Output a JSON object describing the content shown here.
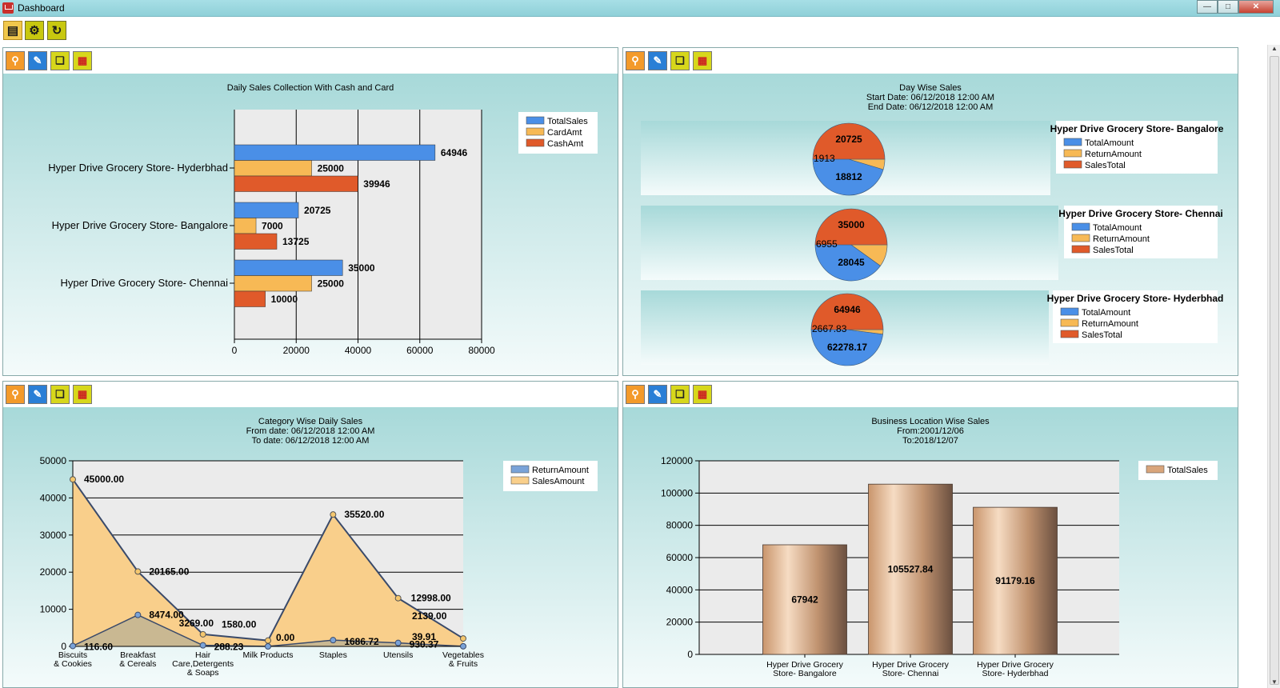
{
  "window": {
    "title": "Dashboard"
  },
  "toolbar": {
    "buttons": [
      "report-icon",
      "settings-icon",
      "refresh-icon"
    ]
  },
  "panel_tools": [
    "zoom-icon",
    "edit-icon",
    "copy-icon",
    "grid-icon"
  ],
  "colors": {
    "blue": "#4a8fe7",
    "orange": "#f7b955",
    "red": "#e05a2a",
    "bronze": "#d9a57b"
  },
  "chart_data": [
    {
      "type": "bar",
      "title": "Daily Sales Collection With Cash and Card",
      "orientation": "horizontal",
      "categories": [
        "Hyper Drive Grocery Store- Hyderbhad",
        "Hyper Drive Grocery Store- Bangalore",
        "Hyper Drive Grocery Store- Chennai"
      ],
      "series": [
        {
          "name": "TotalSales",
          "values": [
            64946,
            20725,
            35000
          ],
          "labels": [
            "64946",
            "20725",
            "35000"
          ]
        },
        {
          "name": "CardAmt",
          "values": [
            25000,
            7000,
            25000
          ],
          "labels": [
            "25000",
            "7000",
            "25000"
          ]
        },
        {
          "name": "CashAmt",
          "values": [
            39946,
            13725,
            10000
          ],
          "labels": [
            "39946",
            "13725",
            "10000"
          ]
        }
      ],
      "xlim": [
        0,
        80000
      ],
      "ticks": [
        "0",
        "20000",
        "40000",
        "60000",
        "80000"
      ],
      "legend": "top-right"
    },
    {
      "type": "pie",
      "title": "Day Wise Sales",
      "subtitle1": "Start Date: 06/12/2018 12:00 AM",
      "subtitle2": "End Date: 06/12/2018 12:00 AM",
      "series_names": [
        "TotalAmount",
        "ReturnAmount",
        "SalesTotal"
      ],
      "pies": [
        {
          "name": "Hyper Drive Grocery Store- Bangalore",
          "values": [
            18812,
            1913,
            20725
          ],
          "labels": [
            "18812",
            "1913",
            "20725"
          ]
        },
        {
          "name": "Hyper Drive Grocery Store- Chennai",
          "values": [
            28045,
            6955,
            35000
          ],
          "labels": [
            "28045",
            "6955",
            "35000"
          ]
        },
        {
          "name": "Hyper Drive Grocery Store- Hyderbhad",
          "values": [
            62278.17,
            2667.83,
            64946
          ],
          "labels": [
            "62278.17",
            "2667.83",
            "64946"
          ]
        }
      ]
    },
    {
      "type": "area",
      "title": "Category Wise Daily Sales",
      "subtitle1": "From date: 06/12/2018 12:00 AM",
      "subtitle2": "To date: 06/12/2018 12:00 AM",
      "categories": [
        [
          "Biscuits",
          "& Cookies"
        ],
        [
          "Breakfast",
          "& Cereals"
        ],
        [
          "Hair",
          "Care,Detergents",
          "& Soaps"
        ],
        [
          "Milk Products"
        ],
        [
          "Staples"
        ],
        [
          "Utensils"
        ],
        [
          "Vegetables",
          "& Fruits"
        ]
      ],
      "series": [
        {
          "name": "ReturnAmount",
          "values": [
            116.6,
            8474,
            288.23,
            0,
            1686.72,
            930.37,
            39.91
          ],
          "labels": [
            "116.60",
            "8474.00",
            "288.23",
            "0.00",
            "1686.72",
            "930.37",
            "39.91"
          ]
        },
        {
          "name": "SalesAmount",
          "values": [
            45000,
            20165,
            3269,
            1580,
            35520,
            12998,
            2139
          ],
          "labels": [
            "45000.00",
            "20165.00",
            "3269.00",
            "1580.00",
            "35520.00",
            "12998.00",
            "2139.00"
          ]
        }
      ],
      "ylim": [
        0,
        50000
      ],
      "ticks": [
        "0",
        "10000",
        "20000",
        "30000",
        "40000",
        "50000"
      ],
      "legend": "top-right"
    },
    {
      "type": "bar",
      "title": "Business Location Wise Sales",
      "subtitle1": "From:2001/12/06",
      "subtitle2": "To:2018/12/07",
      "categories": [
        [
          "Hyper Drive Grocery",
          "Store- Bangalore"
        ],
        [
          "Hyper Drive Grocery",
          "Store- Chennai"
        ],
        [
          "Hyper Drive Grocery",
          "Store- Hyderbhad"
        ]
      ],
      "series": [
        {
          "name": "TotalSales",
          "values": [
            67942,
            105527.84,
            91179.16
          ],
          "labels": [
            "67942",
            "105527.84",
            "91179.16"
          ]
        }
      ],
      "ylim": [
        0,
        120000
      ],
      "ticks": [
        "0",
        "20000",
        "40000",
        "60000",
        "80000",
        "100000",
        "120000"
      ],
      "legend": "top-right"
    }
  ]
}
